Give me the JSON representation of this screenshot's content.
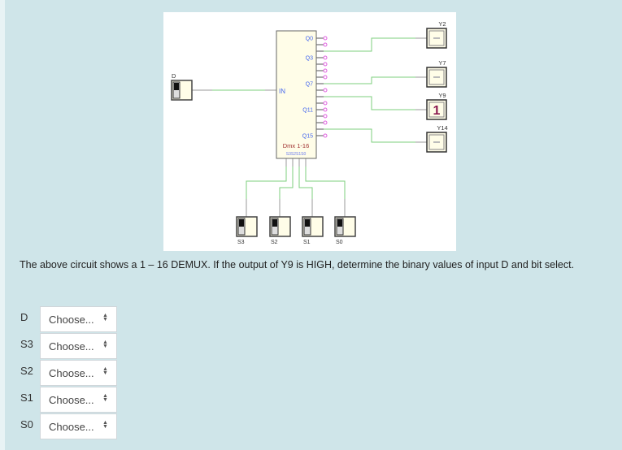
{
  "circuit": {
    "input_label": "D",
    "in_pin": "IN",
    "chip_name": "Dmx 1-16",
    "select_pins": "S3S2S1S0",
    "output_pin_labels": [
      "Q0",
      "Q3",
      "Q7",
      "Q11",
      "Q15"
    ],
    "outputs": [
      {
        "label": "Y2",
        "value": ""
      },
      {
        "label": "Y7",
        "value": ""
      },
      {
        "label": "Y9",
        "value": "1"
      },
      {
        "label": "Y14",
        "value": ""
      }
    ],
    "switches": [
      "S3",
      "S2",
      "S1",
      "S0"
    ]
  },
  "question": "The above circuit shows a 1 – 16 DEMUX. If the output of Y9 is HIGH, determine the binary values of input D and bit select.",
  "answers": [
    {
      "label": "D",
      "value": "Choose..."
    },
    {
      "label": "S3",
      "value": "Choose..."
    },
    {
      "label": "S2",
      "value": "Choose..."
    },
    {
      "label": "S1",
      "value": "Choose..."
    },
    {
      "label": "S0",
      "value": "Choose..."
    }
  ]
}
